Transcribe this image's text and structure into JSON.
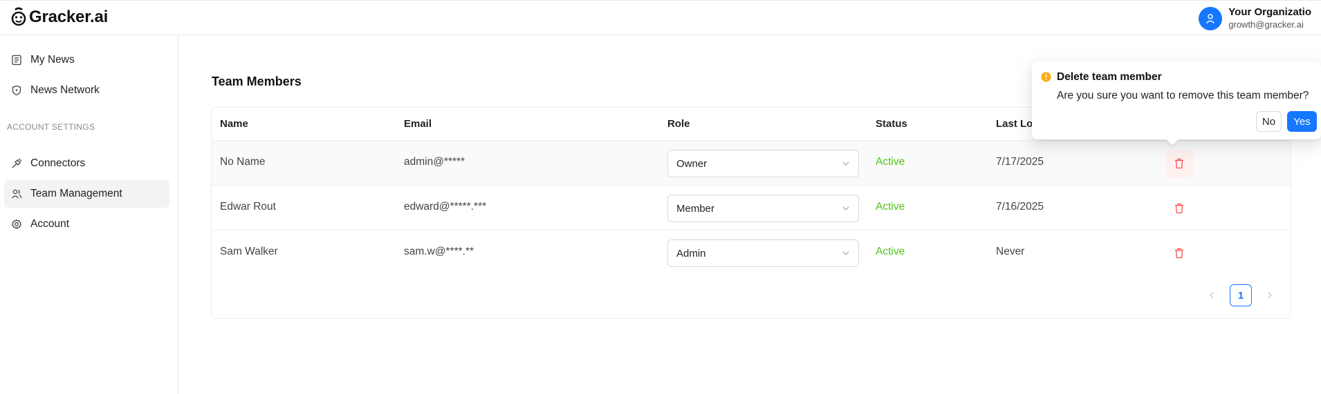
{
  "header": {
    "logo_text": "Gracker.ai",
    "org_name": "Your Organizatio",
    "user_email": "growth@gracker.ai"
  },
  "sidebar": {
    "items": [
      {
        "label": "My News",
        "icon": "newspaper-icon"
      },
      {
        "label": "News Network",
        "icon": "shield-icon"
      }
    ],
    "section_label": "ACCOUNT SETTINGS",
    "settings_items": [
      {
        "label": "Connectors",
        "icon": "plug-icon"
      },
      {
        "label": "Team Management",
        "icon": "users-icon",
        "active": true
      },
      {
        "label": "Account",
        "icon": "gear-icon"
      }
    ]
  },
  "main": {
    "title": "Team Members",
    "columns": [
      "Name",
      "Email",
      "Role",
      "Status",
      "Last Lo"
    ],
    "rows": [
      {
        "name": "No Name",
        "email": "admin@*****",
        "role": "Owner",
        "status": "Active",
        "last_login": "7/17/2025"
      },
      {
        "name": "Edwar Rout",
        "email": "edward@*****.***",
        "role": "Member",
        "status": "Active",
        "last_login": "7/16/2025"
      },
      {
        "name": "Sam Walker",
        "email": "sam.w@****.**",
        "role": "Admin",
        "status": "Active",
        "last_login": "Never"
      }
    ],
    "pagination": {
      "current_page": "1"
    }
  },
  "popconfirm": {
    "title": "Delete team member",
    "description": "Are you sure you want to remove this team member?",
    "cancel_label": "No",
    "confirm_label": "Yes"
  },
  "colors": {
    "accent": "#1677ff",
    "status_active": "#52c41a",
    "danger": "#ff4d4f",
    "warning": "#faad14"
  }
}
